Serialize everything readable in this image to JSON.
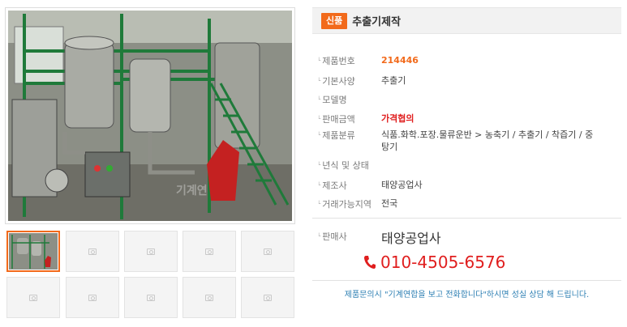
{
  "product": {
    "badge": "신품",
    "title": "추출기제작",
    "photo_watermark": "기계연"
  },
  "gallery": {
    "thumbnails": [
      {
        "selected": true,
        "icon": "product-photo"
      },
      {
        "selected": false,
        "icon": "image-placeholder-icon"
      },
      {
        "selected": false,
        "icon": "image-placeholder-icon"
      },
      {
        "selected": false,
        "icon": "image-placeholder-icon"
      },
      {
        "selected": false,
        "icon": "image-placeholder-icon"
      },
      {
        "selected": false,
        "icon": "image-placeholder-icon"
      },
      {
        "selected": false,
        "icon": "image-placeholder-icon"
      },
      {
        "selected": false,
        "icon": "image-placeholder-icon"
      },
      {
        "selected": false,
        "icon": "image-placeholder-icon"
      },
      {
        "selected": false,
        "icon": "image-placeholder-icon"
      }
    ]
  },
  "specs": [
    {
      "label": "제품번호",
      "value": "214446"
    },
    {
      "label": "기본사양",
      "value": "추출기"
    },
    {
      "label": "모델명",
      "value": ""
    },
    {
      "label": "판매금액",
      "value": "가격협의"
    },
    {
      "label": "제품분류",
      "value": "식품.화학.포장.물류운반 > 농축기 / 추출기 / 착즙기 / 중탕기"
    },
    {
      "label": "년식 및 상태",
      "value": ""
    },
    {
      "label": "제조사",
      "value": "태양공업사"
    },
    {
      "label": "거래가능지역",
      "value": "전국"
    }
  ],
  "seller": {
    "label": "판매사",
    "name": "태양공업사",
    "phone": "010-4505-6576"
  },
  "inquiry_note": "제품문의시 \"기계연합을 보고 전화합니다\"하시면 성실 상담 해 드립니다.",
  "colors": {
    "accent_orange": "#f26a1b",
    "price_red": "#e01e1e",
    "note_blue": "#2d7fb3"
  }
}
